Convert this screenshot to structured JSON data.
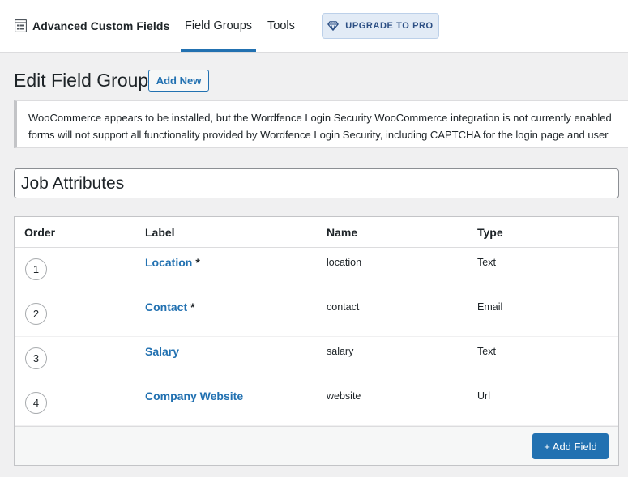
{
  "header": {
    "app_name": "Advanced Custom Fields",
    "app_icon": "acf-logo-icon",
    "tabs": [
      {
        "label": "Field Groups",
        "active": true
      },
      {
        "label": "Tools",
        "active": false
      }
    ],
    "upgrade": {
      "label": "UPGRADE TO PRO",
      "icon": "diamond-icon"
    }
  },
  "page": {
    "title": "Edit Field Group",
    "add_new_label": "Add New"
  },
  "notice": {
    "line1": "WooCommerce appears to be installed, but the Wordfence Login Security WooCommerce integration is not currently enabled",
    "line2": "forms will not support all functionality provided by Wordfence Login Security, including CAPTCHA for the login page and user"
  },
  "field_group": {
    "title_value": "Job Attributes"
  },
  "fields_table": {
    "headers": {
      "order": "Order",
      "label": "Label",
      "name": "Name",
      "type": "Type"
    },
    "rows": [
      {
        "order": "1",
        "label": "Location",
        "required": "*",
        "name": "location",
        "type": "Text"
      },
      {
        "order": "2",
        "label": "Contact",
        "required": "*",
        "name": "contact",
        "type": "Email"
      },
      {
        "order": "3",
        "label": "Salary",
        "required": "",
        "name": "salary",
        "type": "Text"
      },
      {
        "order": "4",
        "label": "Company Website",
        "required": "",
        "name": "website",
        "type": "Url"
      }
    ],
    "add_field_label": "+ Add Field"
  },
  "colors": {
    "accent": "#2271b1",
    "background": "#f0f0f1",
    "upgrade_bg": "#e2ebf6"
  }
}
